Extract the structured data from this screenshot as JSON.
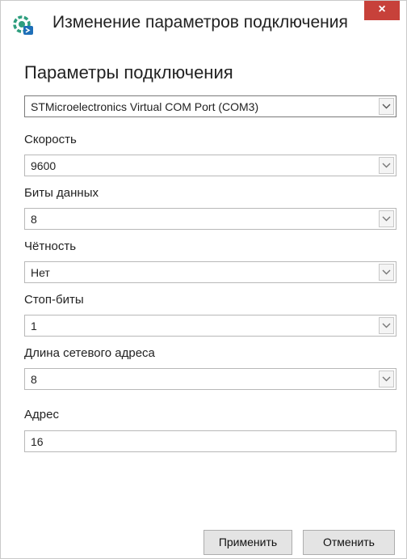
{
  "window": {
    "title": "Изменение параметров подключения",
    "close_glyph": "×"
  },
  "section_title": "Параметры подключения",
  "port": {
    "value": "STMicroelectronics Virtual COM Port (COM3)"
  },
  "fields": {
    "speed": {
      "label": "Скорость",
      "value": "9600"
    },
    "data_bits": {
      "label": "Биты данных",
      "value": "8"
    },
    "parity": {
      "label": "Чётность",
      "value": "Нет"
    },
    "stop_bits": {
      "label": "Стоп-биты",
      "value": "1"
    },
    "address_length": {
      "label": "Длина сетевого адреса",
      "value": "8"
    },
    "address": {
      "label": "Адрес",
      "value": "16"
    }
  },
  "buttons": {
    "apply": "Применить",
    "cancel": "Отменить"
  },
  "colors": {
    "close_button": "#c7413a",
    "app_icon_primary": "#2e9e7e",
    "app_icon_accent": "#1e6fb8"
  },
  "icons": [
    "app-logo-icon",
    "close-icon",
    "chevron-down-icon"
  ]
}
